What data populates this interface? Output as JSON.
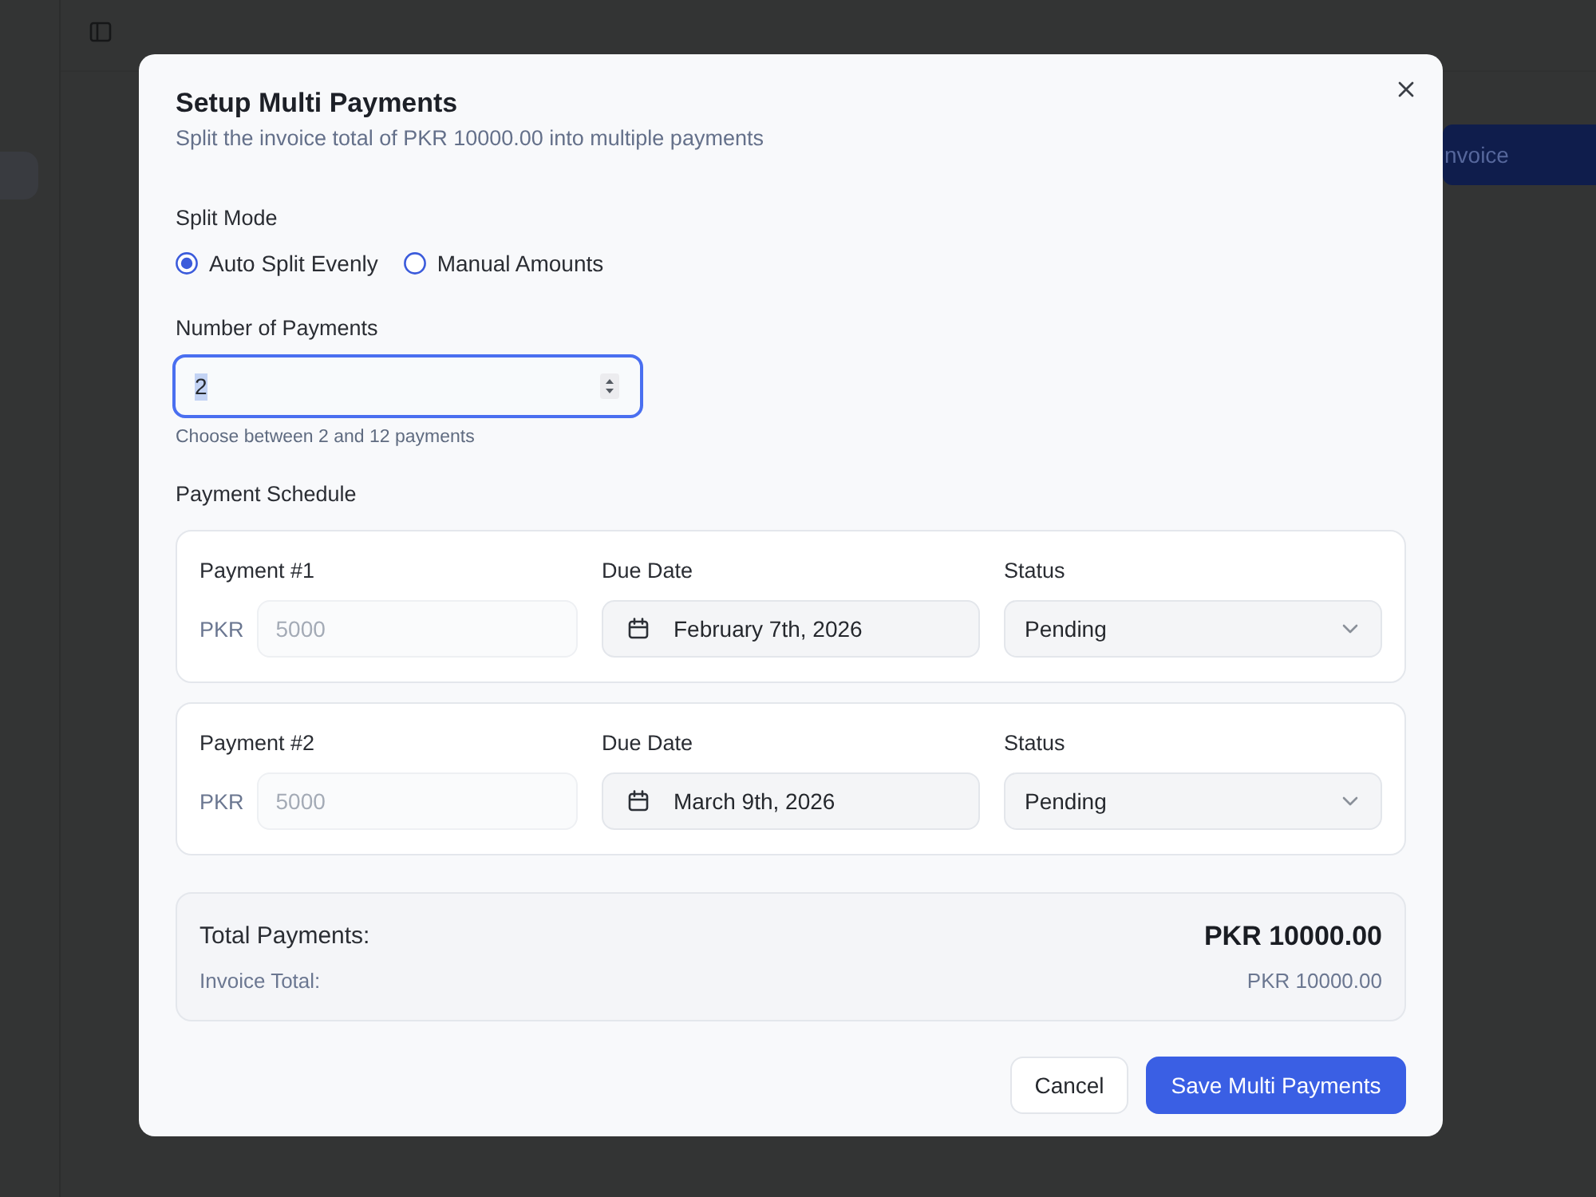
{
  "app": {
    "sidebar": {
      "items": [
        {
          "selected": true
        }
      ]
    },
    "action_button": {
      "label": "nvoice"
    }
  },
  "dialog": {
    "title": "Setup Multi Payments",
    "subtitle": "Split the invoice total of PKR 10000.00 into multiple payments",
    "split_mode": {
      "label": "Split Mode",
      "options": [
        {
          "label": "Auto Split Evenly",
          "selected": true
        },
        {
          "label": "Manual Amounts",
          "selected": false
        }
      ]
    },
    "number_of_payments": {
      "label": "Number of Payments",
      "value": "2",
      "focused": true,
      "value_highlighted": true,
      "hint": "Choose between 2 and 12 payments"
    },
    "schedule": {
      "label": "Payment Schedule",
      "payments": [
        {
          "title": "Payment #1",
          "currency": "PKR",
          "amount": "5000",
          "amount_disabled": true,
          "due_date_label": "Due Date",
          "due_date": "February 7th, 2026",
          "status_label": "Status",
          "status": "Pending"
        },
        {
          "title": "Payment #2",
          "currency": "PKR",
          "amount": "5000",
          "amount_disabled": true,
          "due_date_label": "Due Date",
          "due_date": "March 9th, 2026",
          "status_label": "Status",
          "status": "Pending"
        }
      ]
    },
    "summary": {
      "total_label": "Total Payments:",
      "total_value": "PKR 10000.00",
      "invoice_total_label": "Invoice Total:",
      "invoice_total_value": "PKR 10000.00"
    },
    "buttons": [
      {
        "label": "Cancel",
        "kind": "secondary"
      },
      {
        "label": "Save Multi Payments",
        "kind": "primary"
      }
    ]
  }
}
